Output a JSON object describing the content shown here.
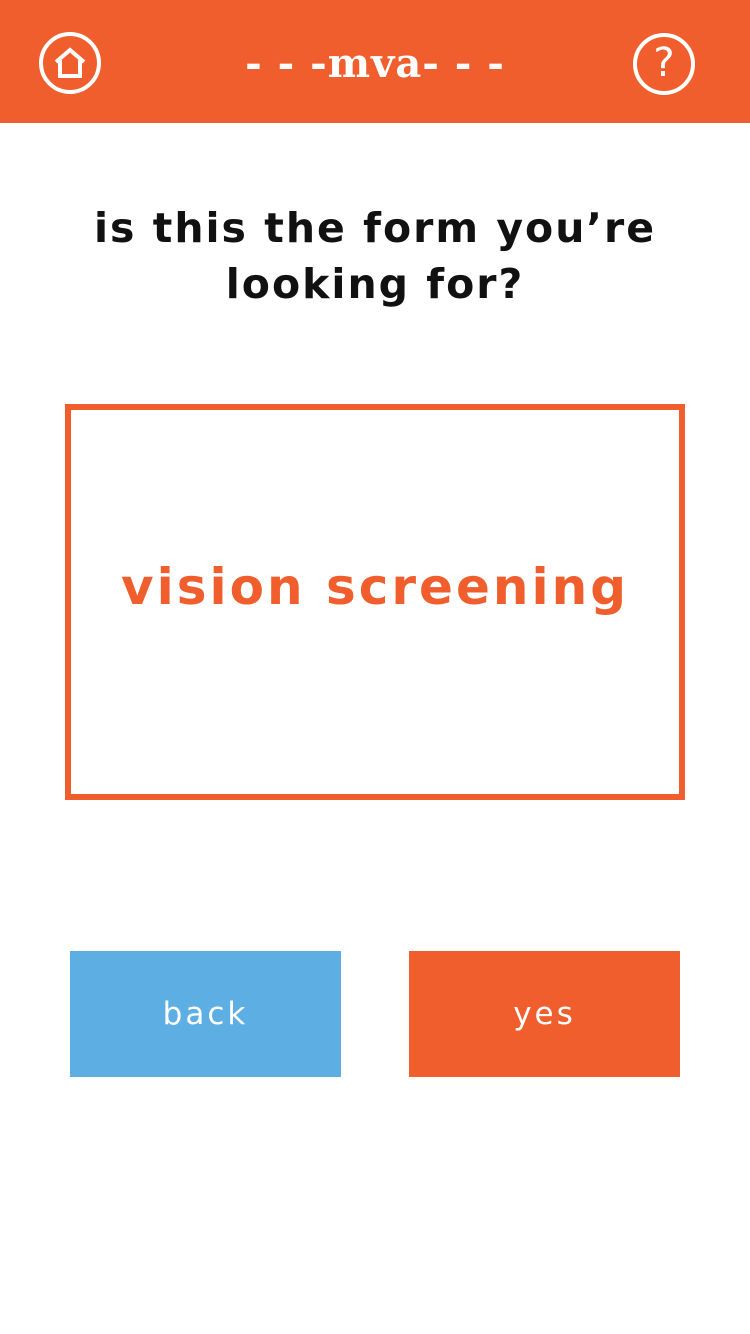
{
  "header": {
    "title": "- - -mva- - -",
    "home_icon": "home-icon",
    "help_icon": "help-icon",
    "help_glyph": "?"
  },
  "question": "is this the form you’re looking for?",
  "form": {
    "name": "vision screening"
  },
  "actions": {
    "back_label": "back",
    "yes_label": "yes"
  },
  "colors": {
    "accent": "#F15E2D",
    "secondary": "#5DAEE2",
    "background": "#FFFFFF",
    "text": "#111111"
  }
}
